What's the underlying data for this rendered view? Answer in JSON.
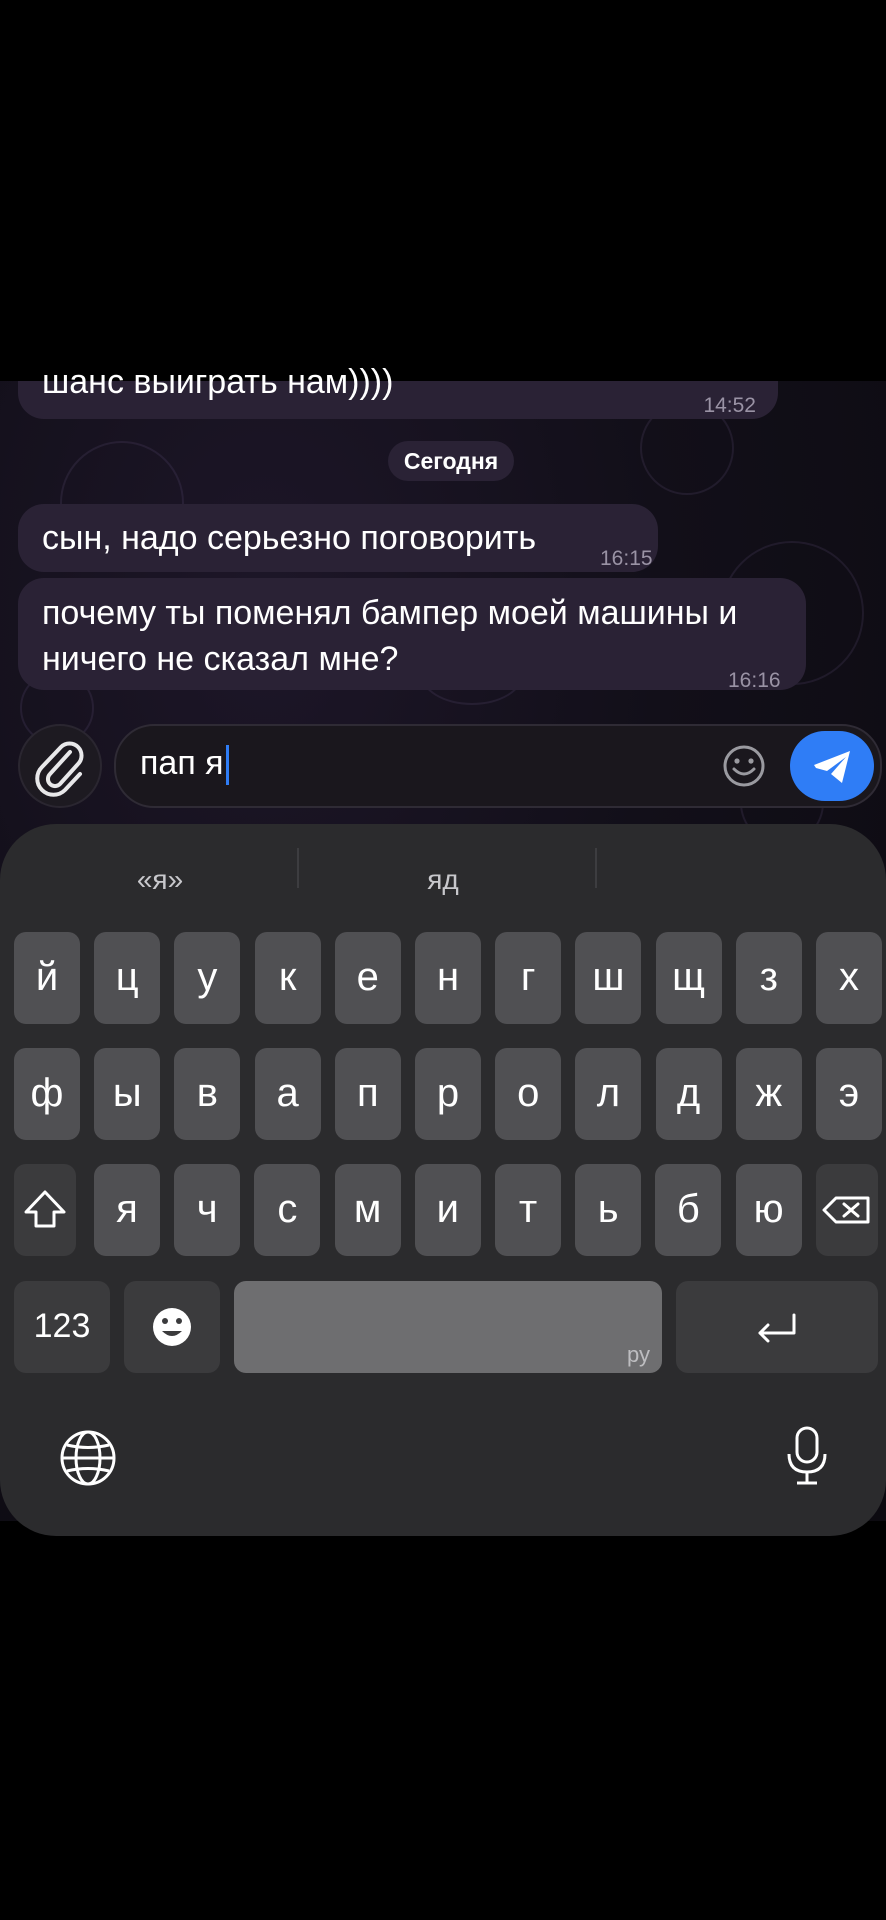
{
  "chat": {
    "messages": [
      {
        "text": "шанс выиграть нам))))",
        "time": "14:52"
      },
      {
        "text": "сын, надо серьезно поговорить",
        "time": "16:15"
      },
      {
        "line1": "почему ты поменял бампер моей машины и",
        "line2": "ничего не сказал мне?",
        "time": "16:16"
      }
    ],
    "date_label": "Сегодня"
  },
  "composer": {
    "text": "пап я",
    "attach_icon": "paperclip-icon",
    "emoji_icon": "smiley-icon",
    "send_icon": "send-arrow-icon",
    "accent": "#2f7df6"
  },
  "keyboard": {
    "suggestions": [
      "«я»",
      "яд",
      ""
    ],
    "row1": [
      "й",
      "ц",
      "у",
      "к",
      "е",
      "н",
      "г",
      "ш",
      "щ",
      "з",
      "х"
    ],
    "row2": [
      "ф",
      "ы",
      "в",
      "а",
      "п",
      "р",
      "о",
      "л",
      "д",
      "ж",
      "э"
    ],
    "row3": [
      "я",
      "ч",
      "с",
      "м",
      "и",
      "т",
      "ь",
      "б",
      "ю"
    ],
    "numbers_label": "123",
    "space_language": "ру",
    "icons": [
      "shift-icon",
      "backspace-icon",
      "emoji-icon",
      "return-icon",
      "globe-icon",
      "microphone-icon"
    ]
  }
}
